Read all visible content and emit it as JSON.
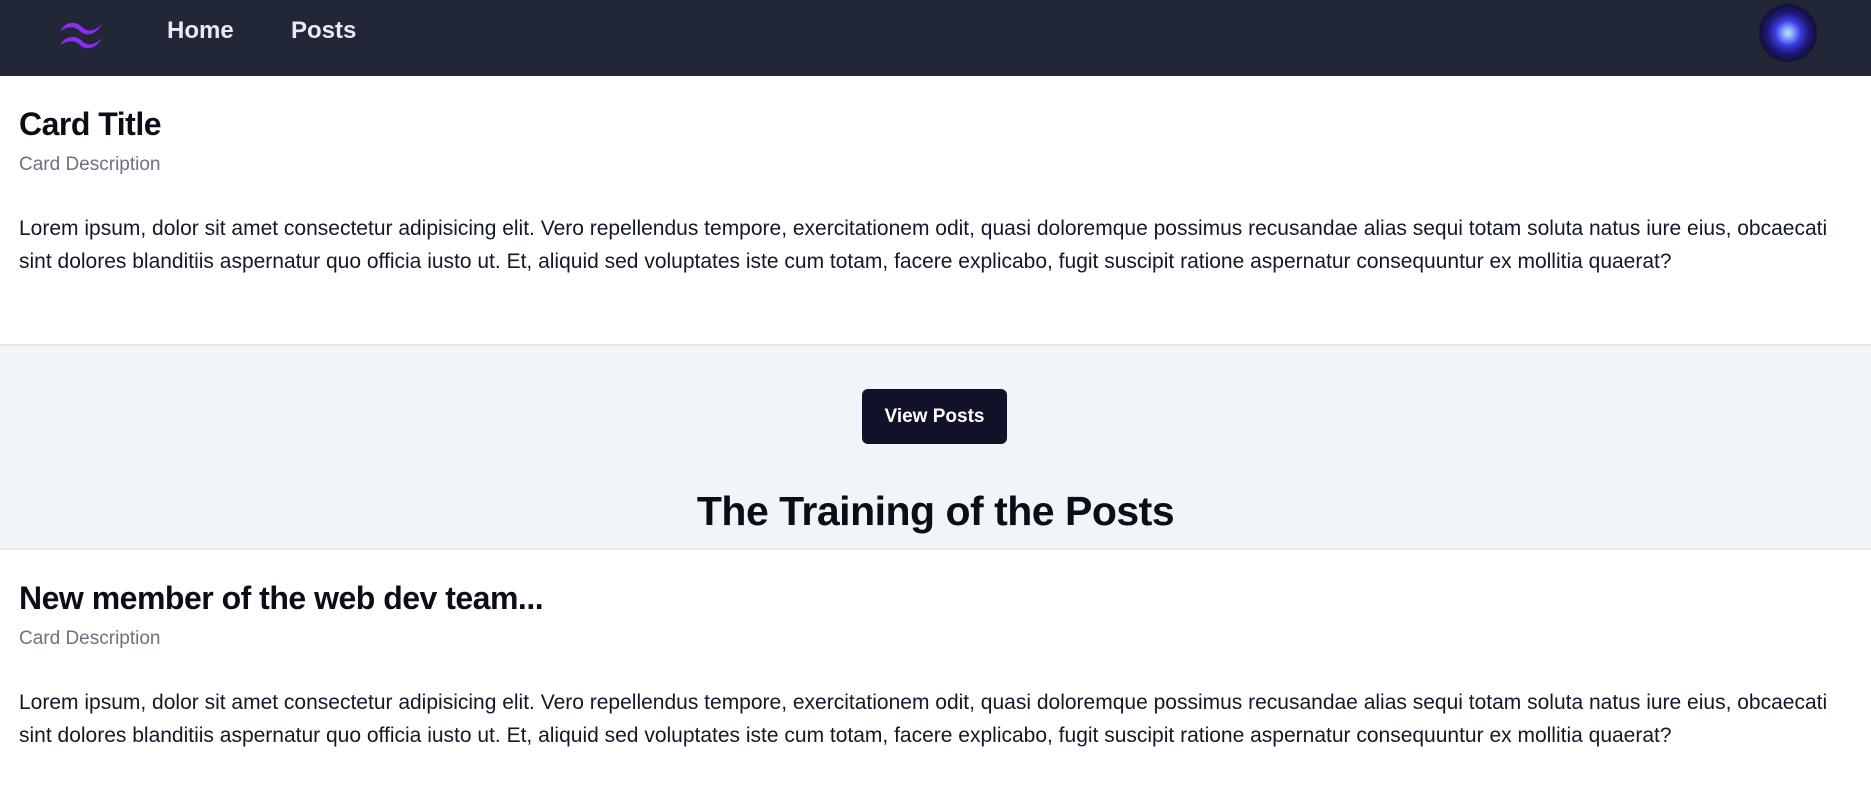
{
  "nav": {
    "logo_icon": "tailwind-logo-icon",
    "links": [
      {
        "label": "Home"
      },
      {
        "label": "Posts"
      }
    ],
    "avatar_icon": "user-avatar"
  },
  "cards": [
    {
      "title": "Card Title",
      "description": "Card Description",
      "body": "Lorem ipsum, dolor sit amet consectetur adipisicing elit. Vero repellendus tempore, exercitationem odit, quasi doloremque possimus recusandae alias sequi totam soluta natus iure eius, obcaecati sint dolores blanditiis aspernatur quo officia iusto ut. Et, aliquid sed voluptates iste cum totam, facere explicabo, fugit suscipit ratione aspernatur consequuntur ex mollitia quaerat?"
    },
    {
      "title": "New member of the web dev team...",
      "description": "Card Description",
      "body": "Lorem ipsum, dolor sit amet consectetur adipisicing elit. Vero repellendus tempore, exercitationem odit, quasi doloremque possimus recusandae alias sequi totam soluta natus iure eius, obcaecati sint dolores blanditiis aspernatur quo officia iusto ut. Et, aliquid sed voluptates iste cum totam, facere explicabo, fugit suscipit ratione aspernatur consequuntur ex mollitia quaerat?"
    }
  ],
  "posts_section": {
    "button_label": "View Posts",
    "title": "The Training of the Posts"
  },
  "colors": {
    "navbar_bg": "#222738",
    "logo_purple": "#8b2cf5",
    "button_bg": "#12112a",
    "page_bg": "#f1f4f8"
  }
}
